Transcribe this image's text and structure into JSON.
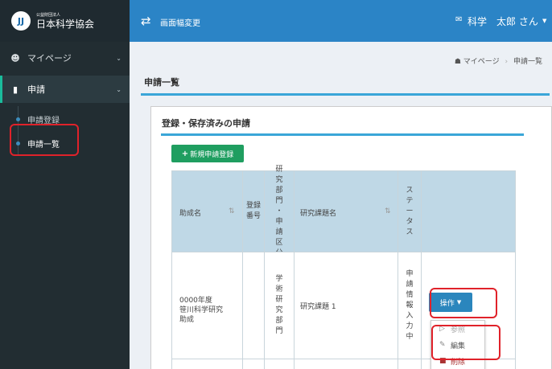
{
  "brand": {
    "logo_text": "JJ",
    "subtitle": "公益財団法人",
    "name": "日本科学協会"
  },
  "sidebar": {
    "mypage_label": "マイページ",
    "apply_label": "申請",
    "sub_items": [
      {
        "label": "申請登録"
      },
      {
        "label": "申請一覧"
      }
    ]
  },
  "topbar": {
    "toggle_label": "画面幅変更",
    "user_label": "科学　太郎 さん"
  },
  "breadcrumb": {
    "home": "マイページ",
    "separator": "›",
    "current": "申請一覧"
  },
  "page": {
    "title": "申請一覧",
    "box_title": "登録・保存済みの申請",
    "new_button": "新規申請登録"
  },
  "table": {
    "headers": {
      "grant_name": "助成名",
      "reg_number": [
        "登録",
        "番号"
      ],
      "field": [
        "研",
        "究",
        "部",
        "門",
        "・",
        "申",
        "請",
        "区",
        "分"
      ],
      "topic": "研究課題名",
      "status": [
        "ス",
        "テ",
        "ー",
        "タ",
        "ス"
      ]
    },
    "row": {
      "grant_name": [
        "0000年度",
        "笹川科学研究",
        "助成"
      ],
      "reg_number": "",
      "field": [
        "学",
        "術",
        "研",
        "究",
        "部",
        "門"
      ],
      "topic": "研究課題 1",
      "status": [
        "申",
        "請",
        "情",
        "報",
        "入",
        "力",
        "中"
      ]
    }
  },
  "actions": {
    "ops_button": "操作",
    "menu": [
      {
        "label": "参照"
      },
      {
        "label": "編集"
      },
      {
        "label": "削除"
      }
    ]
  },
  "colors": {
    "sidebar_bg": "#222d32",
    "topbar_bg": "#2b84c6",
    "accent": "#3aa6d8",
    "new_button": "#1f9e60",
    "ops_button": "#2b86bd",
    "table_header": "#bfd8e6",
    "highlight": "#e0222a"
  }
}
